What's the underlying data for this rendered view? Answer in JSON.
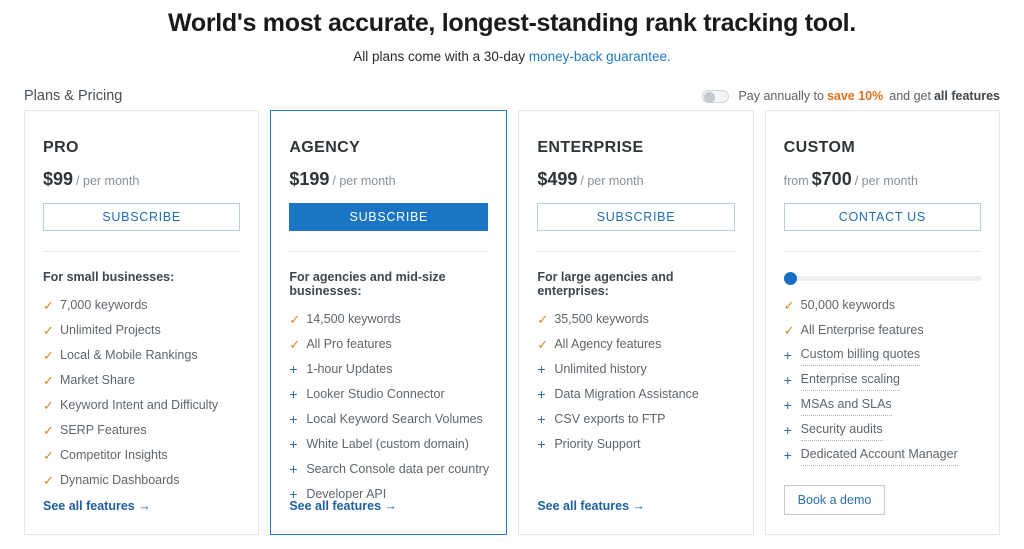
{
  "header": {
    "headline": "World's most accurate, longest-standing rank tracking tool.",
    "subline_pre": "All plans come with a 30-day ",
    "subline_link": "money-back guarantee.",
    "section_title": "Plans & Pricing"
  },
  "annual": {
    "toggle_state": "off",
    "text_pre": "Pay annually to",
    "save": "save 10%",
    "text_mid": "and get",
    "all_features": "all features"
  },
  "colors": {
    "accent_blue": "#1a76c4",
    "link_blue": "#1f7ac4",
    "check_orange": "#d98324",
    "plus_blue": "#2e6da4",
    "save_orange": "#e2711d",
    "featured_border": "#2d7dc4"
  },
  "plans": [
    {
      "name": "PRO",
      "from_label": "",
      "price": "$99",
      "period": "/ per month",
      "cta": "SUBSCRIBE",
      "cta_style": "outline",
      "featured": false,
      "has_slider": false,
      "audience": "For small businesses:",
      "features": [
        {
          "icon": "check",
          "label": "7,000 keywords",
          "hinted": false
        },
        {
          "icon": "check",
          "label": "Unlimited Projects",
          "hinted": false
        },
        {
          "icon": "check",
          "label": "Local & Mobile Rankings",
          "hinted": false
        },
        {
          "icon": "check",
          "label": "Market Share",
          "hinted": false
        },
        {
          "icon": "check",
          "label": "Keyword Intent and Difficulty",
          "hinted": false
        },
        {
          "icon": "check",
          "label": "SERP Features",
          "hinted": false
        },
        {
          "icon": "check",
          "label": "Competitor Insights",
          "hinted": false
        },
        {
          "icon": "check",
          "label": "Dynamic Dashboards",
          "hinted": false
        }
      ],
      "foot_type": "link",
      "foot_label": "See all features"
    },
    {
      "name": "AGENCY",
      "from_label": "",
      "price": "$199",
      "period": "/ per month",
      "cta": "SUBSCRIBE",
      "cta_style": "solid",
      "featured": true,
      "has_slider": false,
      "audience": "For agencies and mid-size businesses:",
      "features": [
        {
          "icon": "check",
          "label": "14,500 keywords",
          "hinted": false
        },
        {
          "icon": "check",
          "label": "All Pro features",
          "hinted": false
        },
        {
          "icon": "plus",
          "label": "1-hour Updates",
          "hinted": false
        },
        {
          "icon": "plus",
          "label": "Looker Studio Connector",
          "hinted": false
        },
        {
          "icon": "plus",
          "label": "Local Keyword Search Volumes",
          "hinted": false
        },
        {
          "icon": "plus",
          "label": "White Label (custom domain)",
          "hinted": false
        },
        {
          "icon": "plus",
          "label": "Search Console data per country",
          "hinted": false
        },
        {
          "icon": "plus",
          "label": "Developer API",
          "hinted": false
        }
      ],
      "foot_type": "link",
      "foot_label": "See all features"
    },
    {
      "name": "ENTERPRISE",
      "from_label": "",
      "price": "$499",
      "period": "/ per month",
      "cta": "SUBSCRIBE",
      "cta_style": "outline",
      "featured": false,
      "has_slider": false,
      "audience": "For large agencies and enterprises:",
      "features": [
        {
          "icon": "check",
          "label": "35,500 keywords",
          "hinted": false
        },
        {
          "icon": "check",
          "label": "All Agency features",
          "hinted": false
        },
        {
          "icon": "plus",
          "label": "Unlimited history",
          "hinted": false
        },
        {
          "icon": "plus",
          "label": "Data Migration Assistance",
          "hinted": false
        },
        {
          "icon": "plus",
          "label": "CSV exports to FTP",
          "hinted": false
        },
        {
          "icon": "plus",
          "label": "Priority Support",
          "hinted": false
        }
      ],
      "foot_type": "link",
      "foot_label": "See all features"
    },
    {
      "name": "CUSTOM",
      "from_label": "from",
      "price": "$700",
      "period": "/ per month",
      "cta": "CONTACT US",
      "cta_style": "outline",
      "featured": false,
      "has_slider": true,
      "slider_position_pct": 0,
      "audience": "",
      "features": [
        {
          "icon": "check",
          "label": "50,000 keywords",
          "hinted": false
        },
        {
          "icon": "check",
          "label": "All Enterprise features",
          "hinted": false
        },
        {
          "icon": "plus",
          "label": "Custom billing quotes",
          "hinted": true
        },
        {
          "icon": "plus",
          "label": "Enterprise scaling",
          "hinted": true
        },
        {
          "icon": "plus",
          "label": "MSAs and SLAs",
          "hinted": true
        },
        {
          "icon": "plus",
          "label": "Security audits",
          "hinted": true
        },
        {
          "icon": "plus",
          "label": "Dedicated Account Manager",
          "hinted": true
        }
      ],
      "foot_type": "button",
      "foot_label": "Book a demo"
    }
  ],
  "icons": {
    "check": "✓",
    "plus": "+",
    "arrow": "→"
  }
}
